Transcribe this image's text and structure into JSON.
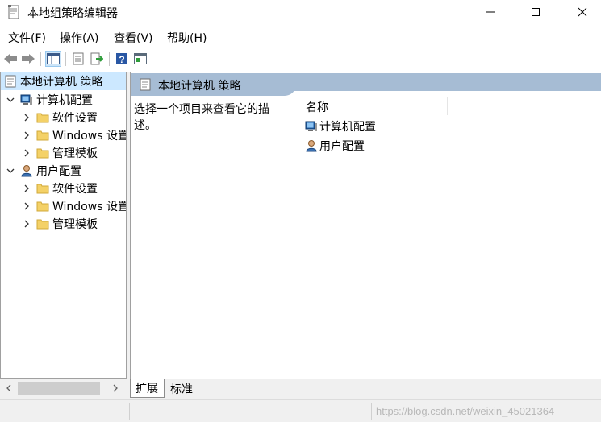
{
  "window": {
    "title": "本地组策略编辑器",
    "controls": [
      "minimize",
      "maximize",
      "close"
    ]
  },
  "menu": {
    "items": [
      {
        "label": "文件(F)"
      },
      {
        "label": "操作(A)"
      },
      {
        "label": "查看(V)"
      },
      {
        "label": "帮助(H)"
      }
    ]
  },
  "toolbar": {
    "buttons": [
      "back-icon",
      "forward-icon",
      "show-tree-icon",
      "properties-icon",
      "export-list-icon",
      "help-icon",
      "show-pane-icon"
    ]
  },
  "tree": {
    "root": "本地计算机 策略",
    "nodes": [
      {
        "label": "计算机配置",
        "expanded": true,
        "icon": "computer-icon",
        "children": [
          {
            "label": "软件设置"
          },
          {
            "label": "Windows 设置"
          },
          {
            "label": "管理模板"
          }
        ]
      },
      {
        "label": "用户配置",
        "expanded": true,
        "icon": "user-icon",
        "children": [
          {
            "label": "软件设置"
          },
          {
            "label": "Windows 设置"
          },
          {
            "label": "管理模板"
          }
        ]
      }
    ]
  },
  "details": {
    "header": "本地计算机 策略",
    "description": "选择一个项目来查看它的描述。",
    "column_name": "名称",
    "items": [
      {
        "label": "计算机配置",
        "icon": "computer-icon"
      },
      {
        "label": "用户配置",
        "icon": "user-icon"
      }
    ]
  },
  "tabs": [
    {
      "label": "扩展",
      "active": true
    },
    {
      "label": "标准",
      "active": false
    }
  ],
  "watermark": "https://blog.csdn.net/weixin_45021364",
  "colors": {
    "selection": "#cce8ff",
    "header_band": "#a6bcd4",
    "folder": "#f4d167"
  }
}
